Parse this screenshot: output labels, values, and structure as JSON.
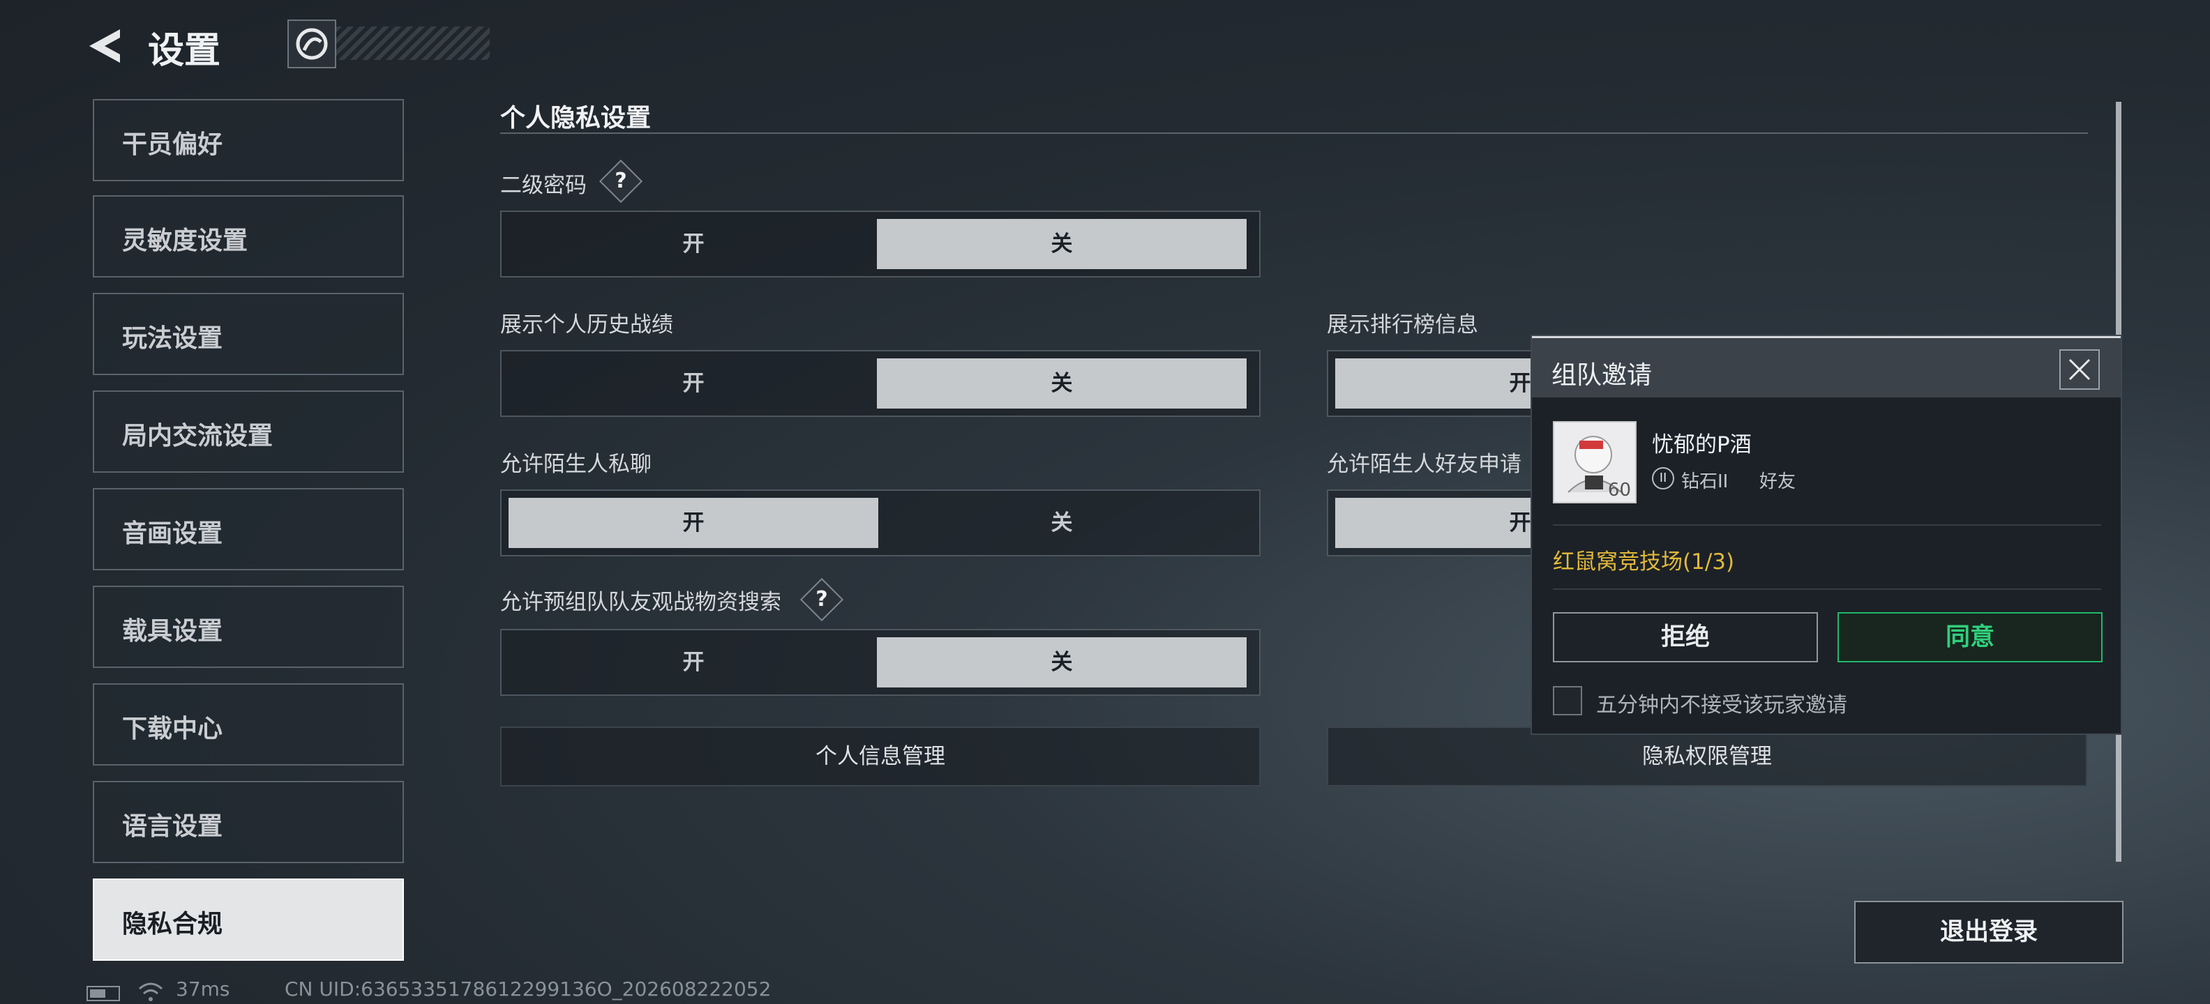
{
  "header": {
    "title": "设置"
  },
  "sidebar": {
    "items": [
      {
        "label": "干员偏好"
      },
      {
        "label": "灵敏度设置"
      },
      {
        "label": "玩法设置"
      },
      {
        "label": "局内交流设置"
      },
      {
        "label": "音画设置"
      },
      {
        "label": "载具设置"
      },
      {
        "label": "下载中心"
      },
      {
        "label": "语言设置"
      },
      {
        "label": "隐私合规",
        "active": true
      }
    ]
  },
  "main": {
    "section_title": "个人隐私设置",
    "settings": {
      "second_password": {
        "label": "二级密码",
        "on": "开",
        "off": "关",
        "selected": "关"
      },
      "show_history": {
        "label": "展示个人历史战绩",
        "on": "开",
        "off": "关",
        "selected": "关"
      },
      "show_leaderboard": {
        "label": "展示排行榜信息",
        "on": "开",
        "selected": "开"
      },
      "stranger_chat": {
        "label": "允许陌生人私聊",
        "on": "开",
        "off": "关",
        "selected": "开"
      },
      "stranger_friend": {
        "label": "允许陌生人好友申请",
        "on": "开",
        "selected": "开"
      },
      "preteam_spectate": {
        "label": "允许预组队队友观战物资搜索",
        "on": "开",
        "off": "关",
        "selected": "关"
      }
    },
    "personal_info_button": "个人信息管理",
    "privacy_permission_button": "隐私权限管理",
    "logout_button": "退出登录"
  },
  "status_bar": {
    "ping": "37ms",
    "uid": "CN UID:6365335178612299136O_202608222052"
  },
  "invite_popup": {
    "title": "组队邀请",
    "player_name": "忧郁的P酒",
    "level": "60",
    "rank_badge": "II",
    "rank": "钻石II",
    "relation": "好友",
    "mode": "红鼠窝竞技场(1/3)",
    "reject_button": "拒绝",
    "agree_button": "同意",
    "checkbox_label": "五分钟内不接受该玩家邀请",
    "accent_color": "#30d07c",
    "mode_color": "#e3b93a"
  }
}
